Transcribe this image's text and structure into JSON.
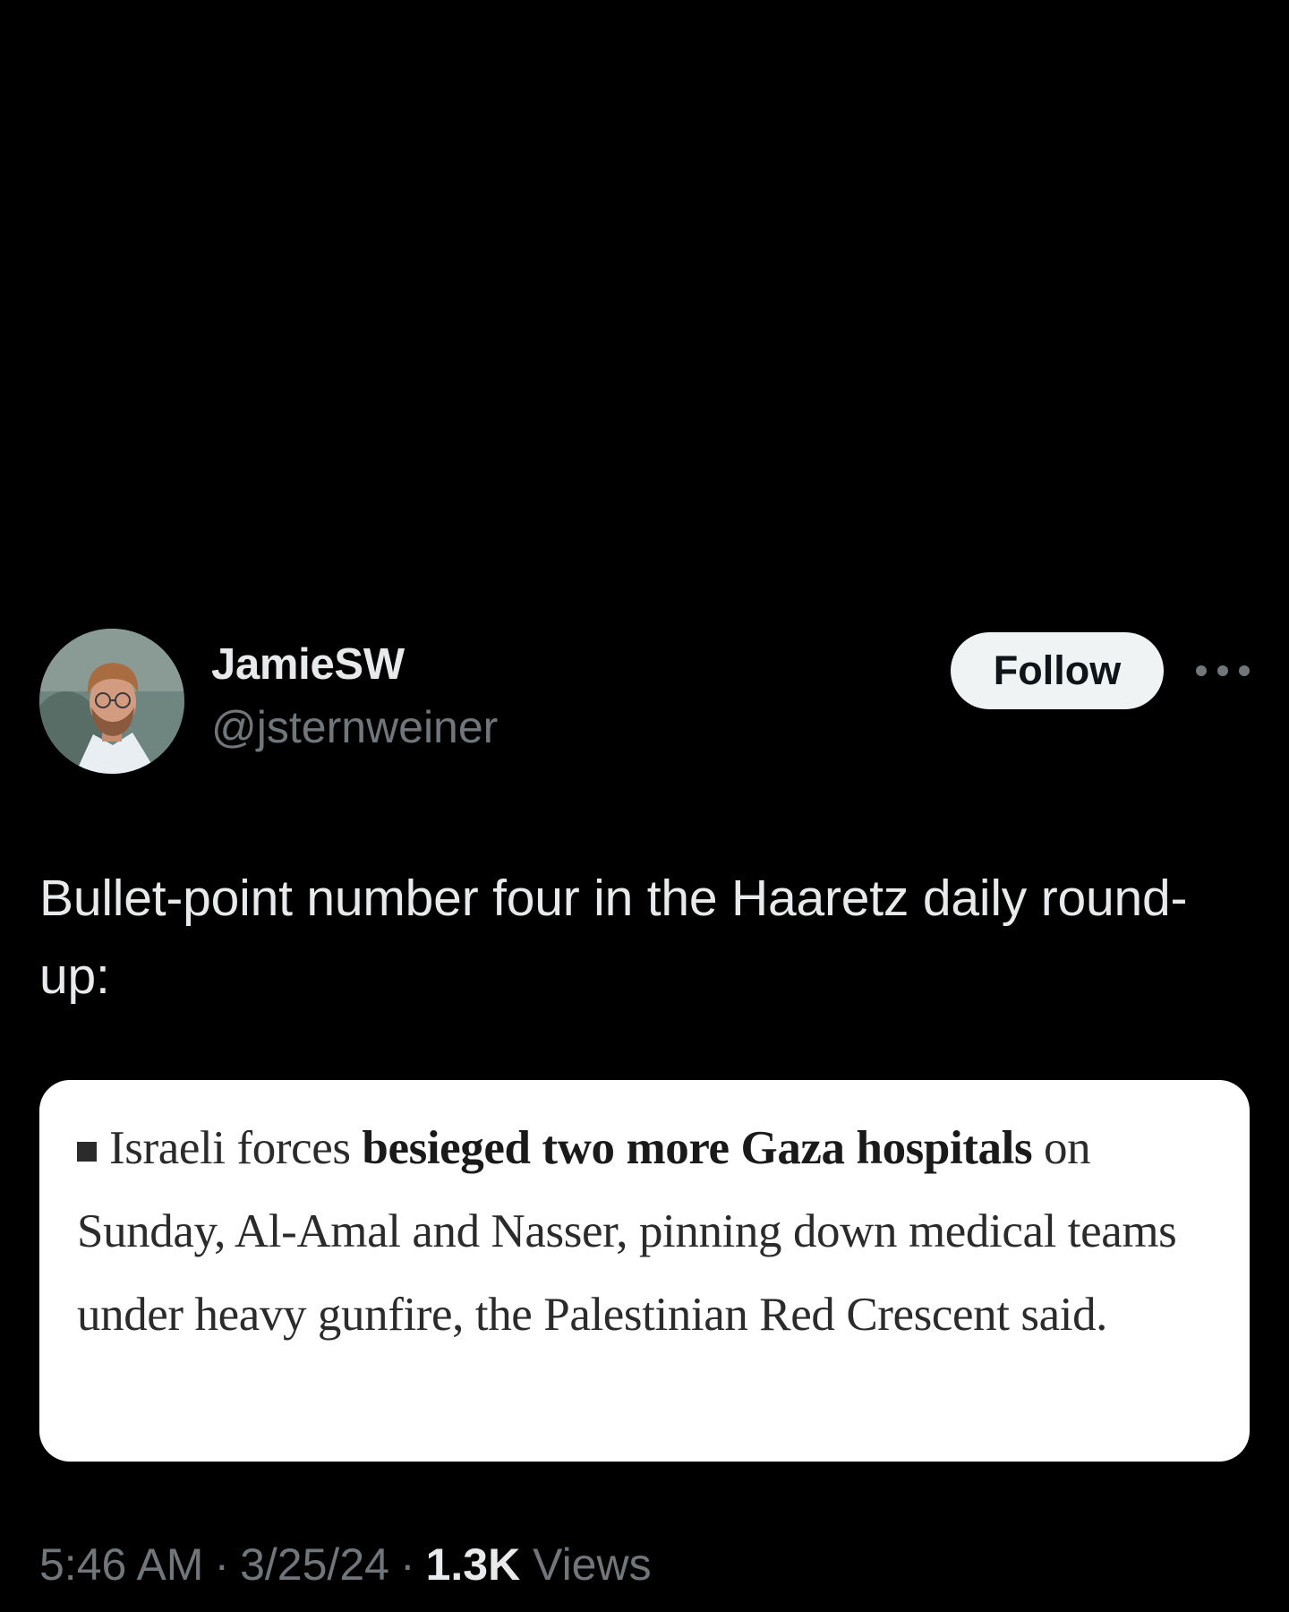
{
  "tweet": {
    "author": {
      "display_name": "JamieSW",
      "handle": "@jsternweiner"
    },
    "follow_label": "Follow",
    "more_icon": "more-horizontal-icon",
    "text": "Bullet-point number four in the Haaretz daily round-up:",
    "quoted_image": {
      "prefix": "Israeli forces ",
      "bold": "besieged two more Gaza hospitals",
      "suffix": " on Sunday, Al-Amal and Nasser, pinning down medical teams under heavy gunfire, the Palestinian Red Crescent said."
    },
    "meta": {
      "time": "5:46 AM",
      "separator": "·",
      "date": "3/25/24",
      "views_count": "1.3K",
      "views_label": "Views"
    }
  },
  "colors": {
    "background": "#000000",
    "primary_text": "#e7e9ea",
    "secondary_text": "#71767b",
    "follow_button_bg": "#eff3f4",
    "card_bg": "#ffffff"
  }
}
